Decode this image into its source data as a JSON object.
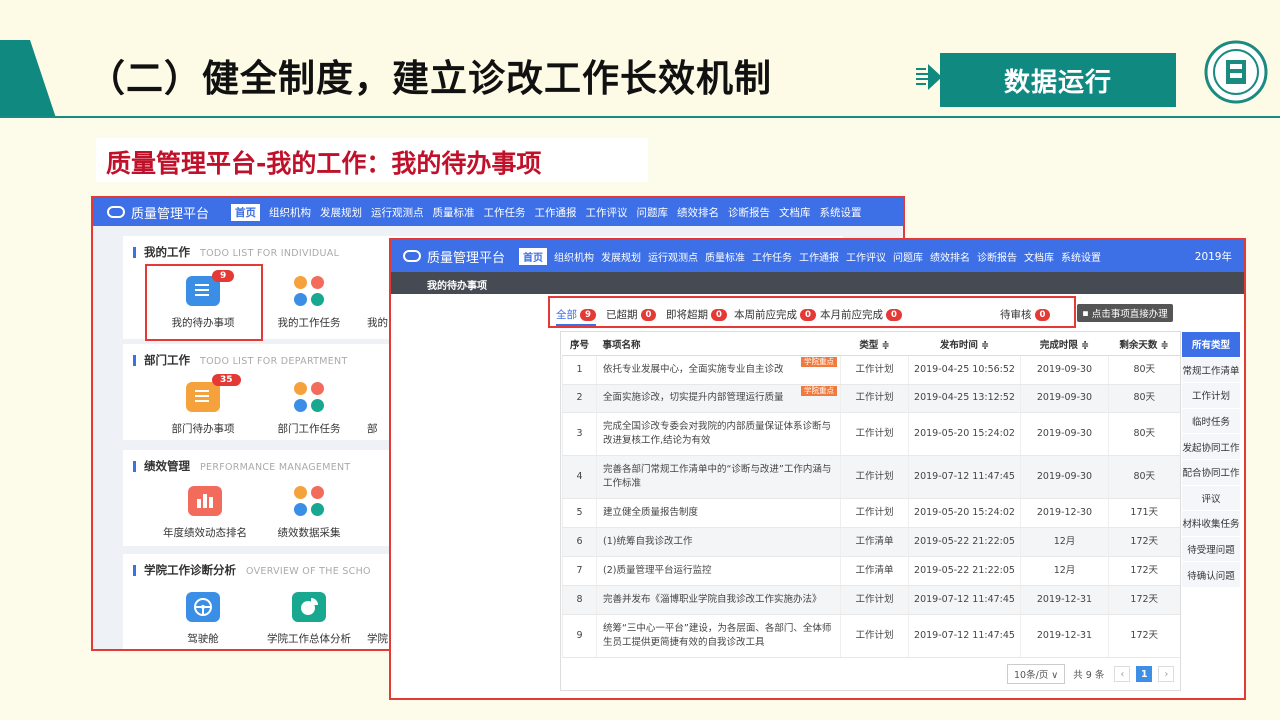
{
  "slide": {
    "title": "（二）健全制度，建立诊改工作长效机制",
    "section_button": "数据运行",
    "subtitle": "质量管理平台-我的工作：我的待办事项"
  },
  "colors": {
    "accent_teal": "#108a80",
    "nav_blue": "#3d6fe6",
    "alert_red": "#e53935",
    "tag_orange": "#f07b3f"
  },
  "bg_app": {
    "brand": "质量管理平台",
    "nav": [
      "首页",
      "组织机构",
      "发展规划",
      "运行观测点",
      "质量标准",
      "工作任务",
      "工作通报",
      "工作评议",
      "问题库",
      "绩效排名",
      "诊断报告",
      "文档库",
      "系统设置"
    ],
    "sections": [
      {
        "title": "我的工作",
        "subtitle": "TODO LIST FOR INDIVIDUAL",
        "tiles": [
          {
            "label": "我的待办事项",
            "badge": "9",
            "icon": "todo-list-icon"
          },
          {
            "label": "我的工作任务",
            "icon": "task-dots-icon"
          },
          {
            "label": "我的",
            "icon": ""
          }
        ]
      },
      {
        "title": "部门工作",
        "subtitle": "TODO LIST FOR DEPARTMENT",
        "tiles": [
          {
            "label": "部门待办事项",
            "badge": "35",
            "icon": "todo-list-icon"
          },
          {
            "label": "部门工作任务",
            "icon": "task-dots-icon"
          },
          {
            "label": "部",
            "icon": ""
          }
        ]
      },
      {
        "title": "绩效管理",
        "subtitle": "PERFORMANCE MANAGEMENT",
        "tiles": [
          {
            "label": "年度绩效动态排名",
            "icon": "bar-chart-icon"
          },
          {
            "label": "绩效数据采集",
            "icon": "task-dots-icon"
          }
        ]
      },
      {
        "title": "学院工作诊断分析",
        "subtitle": "OVERVIEW OF THE SCHO",
        "tiles": [
          {
            "label": "驾驶舱",
            "icon": "steering-wheel-icon"
          },
          {
            "label": "学院工作总体分析",
            "icon": "pie-chart-icon"
          },
          {
            "label": "学院",
            "icon": ""
          }
        ]
      }
    ]
  },
  "fg_app": {
    "brand": "质量管理平台",
    "nav": [
      "首页",
      "组织机构",
      "发展规划",
      "运行观测点",
      "质量标准",
      "工作任务",
      "工作通报",
      "工作评议",
      "问题库",
      "绩效排名",
      "诊断报告",
      "文档库",
      "系统设置"
    ],
    "year": "2019年",
    "breadcrumb": "我的待办事项",
    "filters": [
      {
        "label": "全部",
        "count": "9"
      },
      {
        "label": "已超期",
        "count": "0"
      },
      {
        "label": "即将超期",
        "count": "0"
      },
      {
        "label": "本周前应完成",
        "count": "0"
      },
      {
        "label": "本月前应完成",
        "count": "0"
      },
      {
        "label": "待审核",
        "count": "0"
      }
    ],
    "direct_button": "点击事项直接办理",
    "columns": [
      "序号",
      "事项名称",
      "类型 ≑",
      "发布时间 ≑",
      "完成时限 ≑",
      "剩余天数 ≑"
    ],
    "rows": [
      {
        "no": "1",
        "name": "依托专业发展中心，全面实施专业自主诊改",
        "tag": "学院重点",
        "type": "工作计划",
        "published": "2019-04-25 10:56:52",
        "deadline": "2019-09-30",
        "remaining": "80天"
      },
      {
        "no": "2",
        "name": "全面实施诊改，切实提升内部管理运行质量",
        "tag": "学院重点",
        "type": "工作计划",
        "published": "2019-04-25 13:12:52",
        "deadline": "2019-09-30",
        "remaining": "80天"
      },
      {
        "no": "3",
        "name": "完成全国诊改专委会对我院的内部质量保证体系诊断与改进复核工作,结论为有效",
        "type": "工作计划",
        "published": "2019-05-20 15:24:02",
        "deadline": "2019-09-30",
        "remaining": "80天"
      },
      {
        "no": "4",
        "name": "完善各部门常规工作清单中的“诊断与改进”工作内涵与工作标准",
        "type": "工作计划",
        "published": "2019-07-12 11:47:45",
        "deadline": "2019-09-30",
        "remaining": "80天"
      },
      {
        "no": "5",
        "name": "建立健全质量报告制度",
        "type": "工作计划",
        "published": "2019-05-20 15:24:02",
        "deadline": "2019-12-30",
        "remaining": "171天"
      },
      {
        "no": "6",
        "name": "(1)统筹自我诊改工作",
        "type": "工作清单",
        "published": "2019-05-22 21:22:05",
        "deadline": "12月",
        "remaining": "172天"
      },
      {
        "no": "7",
        "name": "(2)质量管理平台运行监控",
        "type": "工作清单",
        "published": "2019-05-22 21:22:05",
        "deadline": "12月",
        "remaining": "172天"
      },
      {
        "no": "8",
        "name": "完善并发布《淄博职业学院自我诊改工作实施办法》",
        "type": "工作计划",
        "published": "2019-07-12 11:47:45",
        "deadline": "2019-12-31",
        "remaining": "172天"
      },
      {
        "no": "9",
        "name": "统筹“三中心一平台”建设，为各层面、各部门、全体师生员工提供更简捷有效的自我诊改工具",
        "type": "工作计划",
        "published": "2019-07-12 11:47:45",
        "deadline": "2019-12-31",
        "remaining": "172天"
      }
    ],
    "categories": [
      "所有类型",
      "常规工作清单",
      "工作计划",
      "临时任务",
      "发起协同工作",
      "配合协同工作",
      "评议",
      "材料收集任务",
      "待受理问题",
      "待确认问题"
    ],
    "pager": {
      "page_size": "10条/页 ∨",
      "total": "共 9 条",
      "prev": "‹",
      "page": "1",
      "next": "›"
    }
  }
}
